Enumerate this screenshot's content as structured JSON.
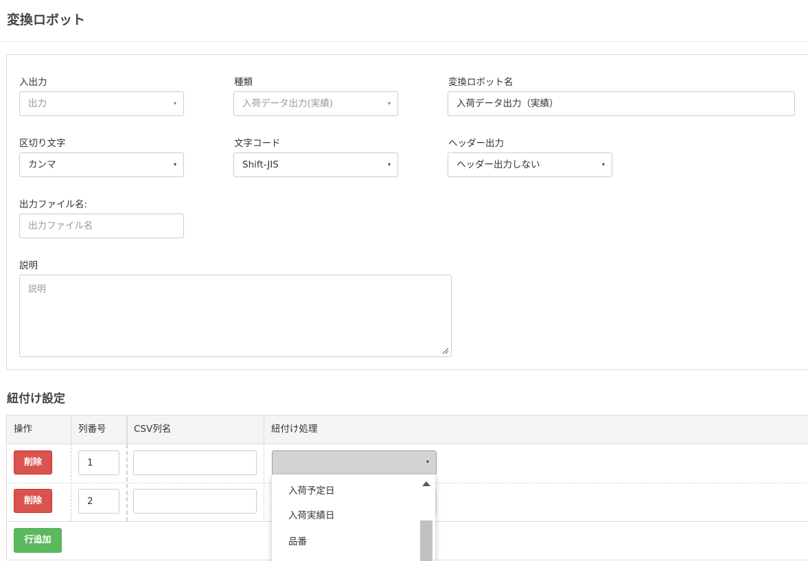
{
  "page": {
    "title": "変換ロボット"
  },
  "form": {
    "io": {
      "label": "入出力",
      "value": "出力"
    },
    "kind": {
      "label": "種類",
      "value": "入荷データ出力(実績)"
    },
    "robot_name": {
      "label": "変換ロボット名",
      "value": "入荷データ出力（実績）"
    },
    "delimiter": {
      "label": "区切り文字",
      "value": "カンマ"
    },
    "charset": {
      "label": "文字コード",
      "value": "Shift-JIS"
    },
    "header_output": {
      "label": "ヘッダー出力",
      "value": "ヘッダー出力しない"
    },
    "output_file": {
      "label": "出力ファイル名:",
      "placeholder": "出力ファイル名"
    },
    "description": {
      "label": "説明",
      "placeholder": "説明"
    },
    "caret": "▾"
  },
  "mapping": {
    "title": "紐付け設定",
    "headers": [
      "操作",
      "列番号",
      "CSV列名",
      "紐付け処理"
    ],
    "rows": [
      {
        "delete_label": "削除",
        "col_no": "1",
        "csv_name": ""
      },
      {
        "delete_label": "削除",
        "col_no": "2",
        "csv_name": ""
      }
    ],
    "add_row_label": "行追加",
    "dropdown_options": [
      "入荷予定日",
      "入荷実績日",
      "品番"
    ]
  },
  "colors": {
    "delete": "#d9534f",
    "add": "#5cb85c"
  }
}
